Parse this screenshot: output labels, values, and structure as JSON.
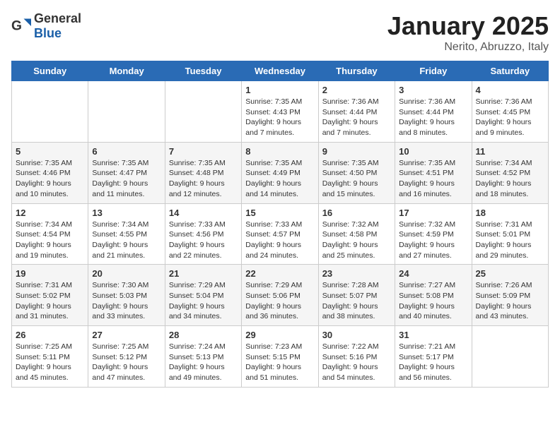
{
  "header": {
    "logo_general": "General",
    "logo_blue": "Blue",
    "month": "January 2025",
    "location": "Nerito, Abruzzo, Italy"
  },
  "weekdays": [
    "Sunday",
    "Monday",
    "Tuesday",
    "Wednesday",
    "Thursday",
    "Friday",
    "Saturday"
  ],
  "weeks": [
    [
      {
        "day": "",
        "info": ""
      },
      {
        "day": "",
        "info": ""
      },
      {
        "day": "",
        "info": ""
      },
      {
        "day": "1",
        "info": "Sunrise: 7:35 AM\nSunset: 4:43 PM\nDaylight: 9 hours\nand 7 minutes."
      },
      {
        "day": "2",
        "info": "Sunrise: 7:36 AM\nSunset: 4:44 PM\nDaylight: 9 hours\nand 7 minutes."
      },
      {
        "day": "3",
        "info": "Sunrise: 7:36 AM\nSunset: 4:44 PM\nDaylight: 9 hours\nand 8 minutes."
      },
      {
        "day": "4",
        "info": "Sunrise: 7:36 AM\nSunset: 4:45 PM\nDaylight: 9 hours\nand 9 minutes."
      }
    ],
    [
      {
        "day": "5",
        "info": "Sunrise: 7:35 AM\nSunset: 4:46 PM\nDaylight: 9 hours\nand 10 minutes."
      },
      {
        "day": "6",
        "info": "Sunrise: 7:35 AM\nSunset: 4:47 PM\nDaylight: 9 hours\nand 11 minutes."
      },
      {
        "day": "7",
        "info": "Sunrise: 7:35 AM\nSunset: 4:48 PM\nDaylight: 9 hours\nand 12 minutes."
      },
      {
        "day": "8",
        "info": "Sunrise: 7:35 AM\nSunset: 4:49 PM\nDaylight: 9 hours\nand 14 minutes."
      },
      {
        "day": "9",
        "info": "Sunrise: 7:35 AM\nSunset: 4:50 PM\nDaylight: 9 hours\nand 15 minutes."
      },
      {
        "day": "10",
        "info": "Sunrise: 7:35 AM\nSunset: 4:51 PM\nDaylight: 9 hours\nand 16 minutes."
      },
      {
        "day": "11",
        "info": "Sunrise: 7:34 AM\nSunset: 4:52 PM\nDaylight: 9 hours\nand 18 minutes."
      }
    ],
    [
      {
        "day": "12",
        "info": "Sunrise: 7:34 AM\nSunset: 4:54 PM\nDaylight: 9 hours\nand 19 minutes."
      },
      {
        "day": "13",
        "info": "Sunrise: 7:34 AM\nSunset: 4:55 PM\nDaylight: 9 hours\nand 21 minutes."
      },
      {
        "day": "14",
        "info": "Sunrise: 7:33 AM\nSunset: 4:56 PM\nDaylight: 9 hours\nand 22 minutes."
      },
      {
        "day": "15",
        "info": "Sunrise: 7:33 AM\nSunset: 4:57 PM\nDaylight: 9 hours\nand 24 minutes."
      },
      {
        "day": "16",
        "info": "Sunrise: 7:32 AM\nSunset: 4:58 PM\nDaylight: 9 hours\nand 25 minutes."
      },
      {
        "day": "17",
        "info": "Sunrise: 7:32 AM\nSunset: 4:59 PM\nDaylight: 9 hours\nand 27 minutes."
      },
      {
        "day": "18",
        "info": "Sunrise: 7:31 AM\nSunset: 5:01 PM\nDaylight: 9 hours\nand 29 minutes."
      }
    ],
    [
      {
        "day": "19",
        "info": "Sunrise: 7:31 AM\nSunset: 5:02 PM\nDaylight: 9 hours\nand 31 minutes."
      },
      {
        "day": "20",
        "info": "Sunrise: 7:30 AM\nSunset: 5:03 PM\nDaylight: 9 hours\nand 33 minutes."
      },
      {
        "day": "21",
        "info": "Sunrise: 7:29 AM\nSunset: 5:04 PM\nDaylight: 9 hours\nand 34 minutes."
      },
      {
        "day": "22",
        "info": "Sunrise: 7:29 AM\nSunset: 5:06 PM\nDaylight: 9 hours\nand 36 minutes."
      },
      {
        "day": "23",
        "info": "Sunrise: 7:28 AM\nSunset: 5:07 PM\nDaylight: 9 hours\nand 38 minutes."
      },
      {
        "day": "24",
        "info": "Sunrise: 7:27 AM\nSunset: 5:08 PM\nDaylight: 9 hours\nand 40 minutes."
      },
      {
        "day": "25",
        "info": "Sunrise: 7:26 AM\nSunset: 5:09 PM\nDaylight: 9 hours\nand 43 minutes."
      }
    ],
    [
      {
        "day": "26",
        "info": "Sunrise: 7:25 AM\nSunset: 5:11 PM\nDaylight: 9 hours\nand 45 minutes."
      },
      {
        "day": "27",
        "info": "Sunrise: 7:25 AM\nSunset: 5:12 PM\nDaylight: 9 hours\nand 47 minutes."
      },
      {
        "day": "28",
        "info": "Sunrise: 7:24 AM\nSunset: 5:13 PM\nDaylight: 9 hours\nand 49 minutes."
      },
      {
        "day": "29",
        "info": "Sunrise: 7:23 AM\nSunset: 5:15 PM\nDaylight: 9 hours\nand 51 minutes."
      },
      {
        "day": "30",
        "info": "Sunrise: 7:22 AM\nSunset: 5:16 PM\nDaylight: 9 hours\nand 54 minutes."
      },
      {
        "day": "31",
        "info": "Sunrise: 7:21 AM\nSunset: 5:17 PM\nDaylight: 9 hours\nand 56 minutes."
      },
      {
        "day": "",
        "info": ""
      }
    ]
  ]
}
